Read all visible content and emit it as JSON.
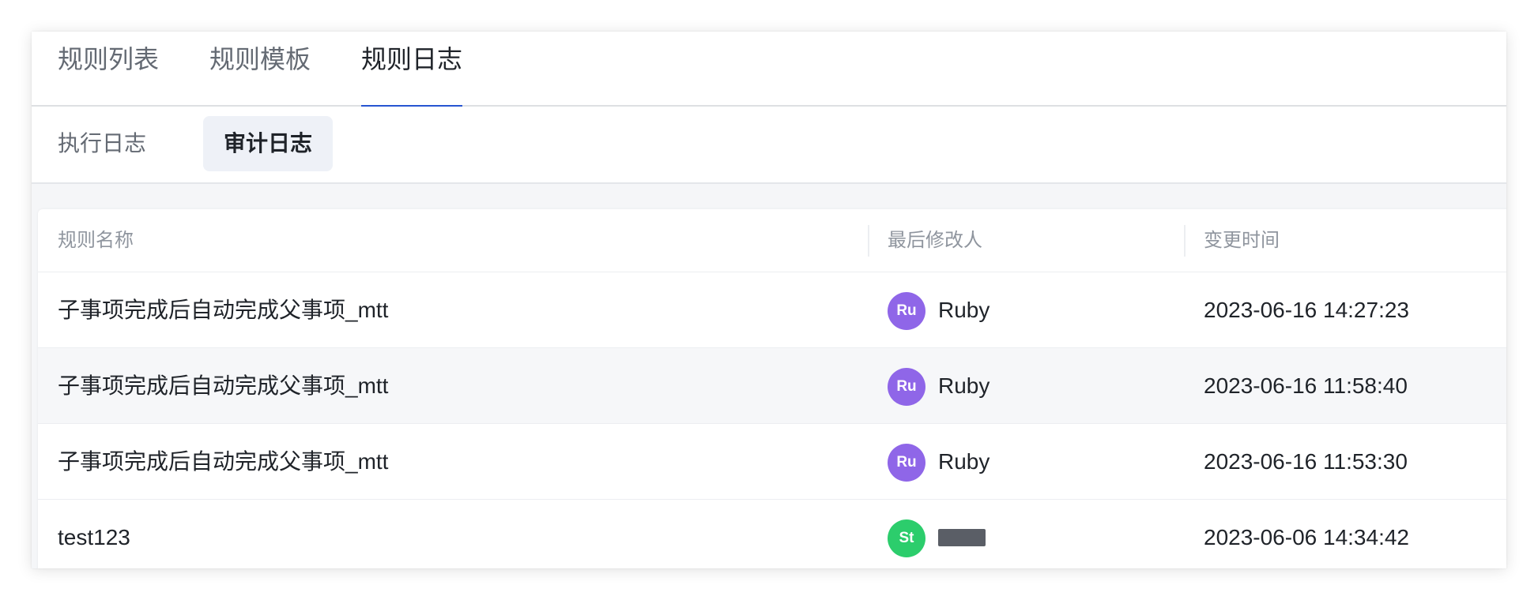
{
  "tabs": [
    {
      "label": "规则列表",
      "active": false
    },
    {
      "label": "规则模板",
      "active": false
    },
    {
      "label": "规则日志",
      "active": true
    }
  ],
  "subtabs": [
    {
      "label": "执行日志",
      "active": false
    },
    {
      "label": "审计日志",
      "active": true
    }
  ],
  "table": {
    "columns": [
      "规则名称",
      "最后修改人",
      "变更时间"
    ],
    "rows": [
      {
        "name": "子事项完成后自动完成父事项_mtt",
        "avatar": "Ru",
        "avatar_color": "#8f66e8",
        "user": "Ruby",
        "time": "2023-06-16 14:27:23"
      },
      {
        "name": "子事项完成后自动完成父事项_mtt",
        "avatar": "Ru",
        "avatar_color": "#8f66e8",
        "user": "Ruby",
        "time": "2023-06-16 11:58:40"
      },
      {
        "name": "子事项完成后自动完成父事项_mtt",
        "avatar": "Ru",
        "avatar_color": "#8f66e8",
        "user": "Ruby",
        "time": "2023-06-16 11:53:30"
      },
      {
        "name": "test123",
        "avatar": "St",
        "avatar_color": "#2ccd6c",
        "user": "",
        "time": "2023-06-06 14:34:42"
      }
    ]
  },
  "colors": {
    "accent": "#2755d1",
    "active_subtab_bg": "#eef1f7"
  }
}
